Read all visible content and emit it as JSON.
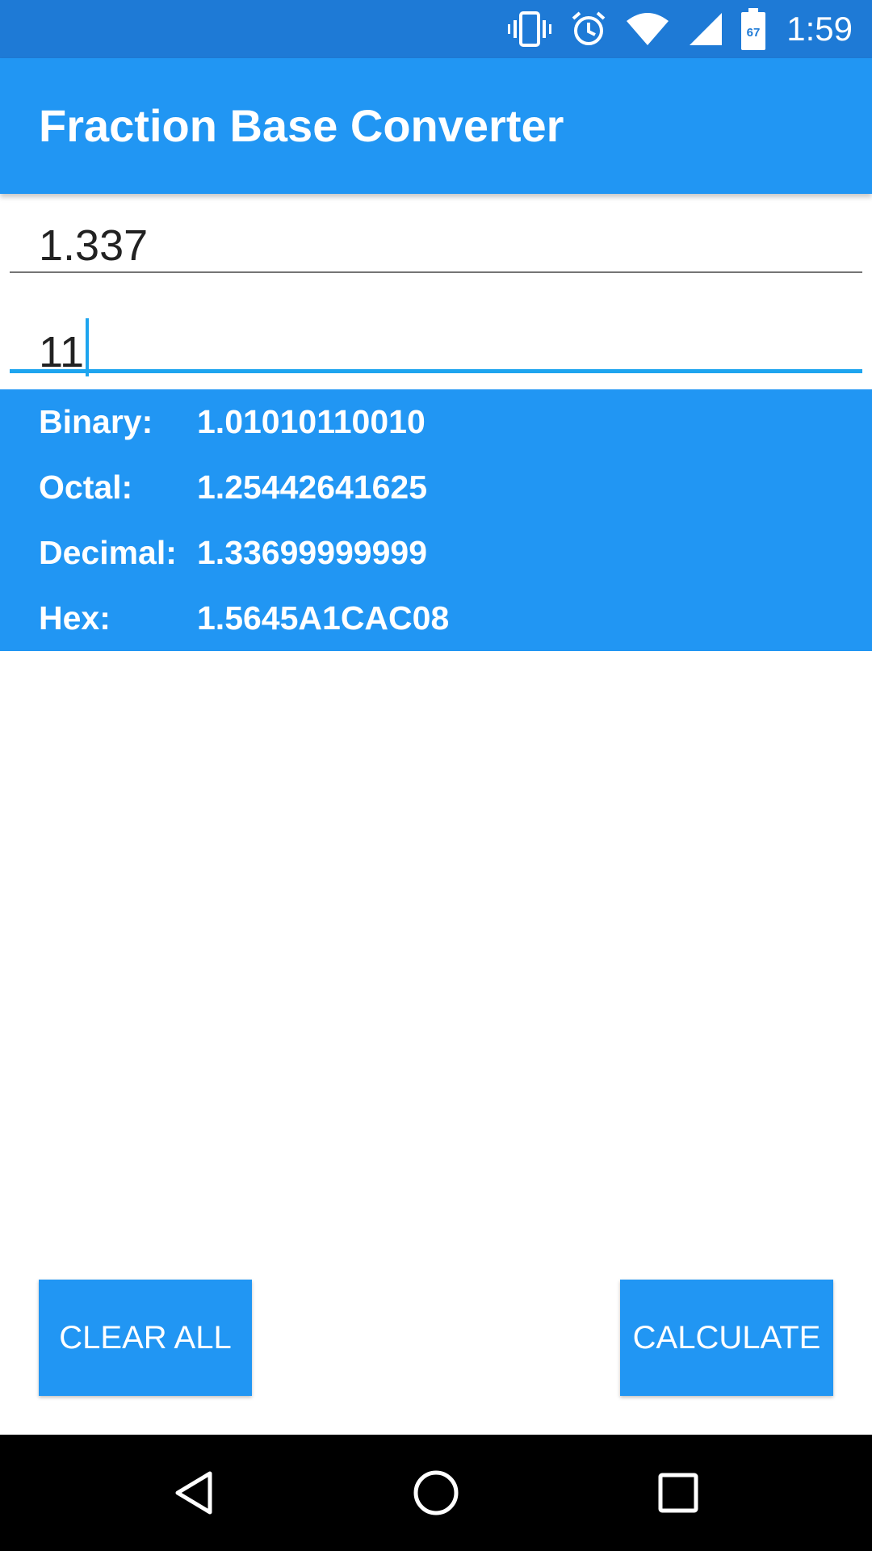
{
  "status_bar": {
    "time": "1:59",
    "battery_level": "67",
    "icons": [
      "vibrate-icon",
      "alarm-icon",
      "wifi-icon",
      "signal-icon",
      "battery-icon"
    ]
  },
  "app_bar": {
    "title": "Fraction Base Converter"
  },
  "inputs": {
    "number_value": "1.337",
    "digits_value": "11",
    "focused": "digits"
  },
  "results": [
    {
      "label": "Binary:",
      "value": "1.01010110010"
    },
    {
      "label": "Octal:",
      "value": "1.25442641625"
    },
    {
      "label": "Decimal:",
      "value": "1.33699999999"
    },
    {
      "label": "Hex:",
      "value": "1.5645A1CAC08"
    }
  ],
  "buttons": {
    "clear_label": "CLEAR ALL",
    "calculate_label": "CALCULATE"
  },
  "nav_bar": {
    "icons": [
      "back-icon",
      "home-icon",
      "recents-icon"
    ]
  },
  "colors": {
    "status_bar": "#1E7AD6",
    "primary": "#2196F3",
    "accent": "#1EA5EF"
  }
}
